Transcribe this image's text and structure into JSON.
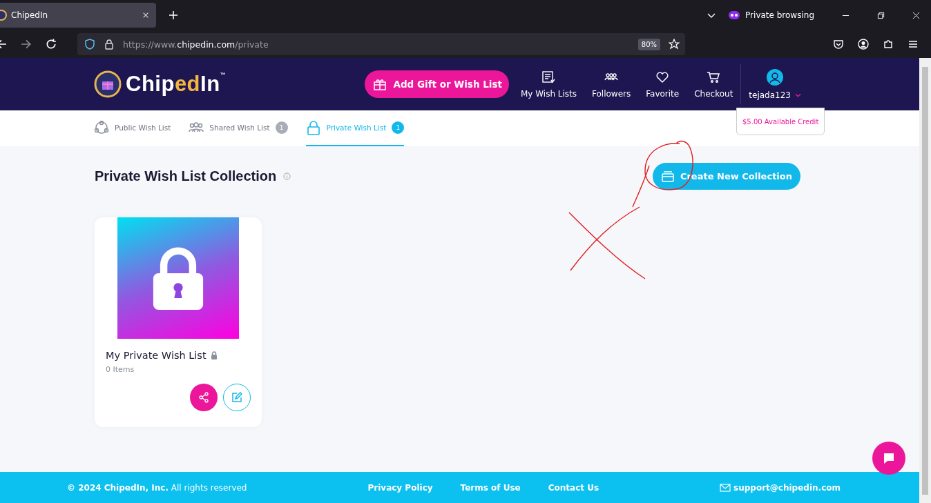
{
  "browser": {
    "tab_title": "ChipedIn",
    "private_label": "Private browsing",
    "url_host": "https://www.",
    "url_domain": "chipedin.com",
    "url_path": "/private",
    "zoom": "80%"
  },
  "header": {
    "logo": {
      "prefix": "Chip",
      "accent": "ed",
      "suffix": "In",
      "mark": "™"
    },
    "cta": "Add Gift or Wish List",
    "nav": [
      {
        "label": "My Wish Lists",
        "kind": "list"
      },
      {
        "label": "Followers",
        "kind": "people"
      },
      {
        "label": "Favorite",
        "kind": "heart"
      },
      {
        "label": "Checkout",
        "kind": "cart"
      }
    ],
    "user": "tejada123",
    "credit": "$5.00 Available Credit"
  },
  "tabs": [
    {
      "label": "Public Wish List",
      "kind": "public",
      "selected": false
    },
    {
      "label": "Shared Wish List",
      "kind": "shared",
      "count": "1",
      "selected": false
    },
    {
      "label": "Private Wish List",
      "kind": "private",
      "count": "1",
      "selected": true
    }
  ],
  "page": {
    "title": "Private Wish List Collection",
    "create_button": "Create New Collection"
  },
  "collections": [
    {
      "name": "My Private Wish List",
      "count": "0 Items"
    }
  ],
  "footer": {
    "copyright": "**© 2024 ChipedIn, Inc.** All rights reserved",
    "links": [
      "Privacy Policy",
      "Terms of Use",
      "Contact Us"
    ],
    "email": "support@chipedin.com"
  }
}
